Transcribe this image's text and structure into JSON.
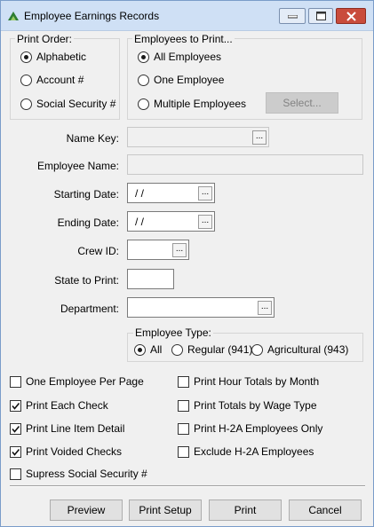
{
  "window": {
    "title": "Employee Earnings Records"
  },
  "print_order": {
    "legend": "Print Order:",
    "options": [
      "Alphabetic",
      "Account #",
      "Social Security #"
    ],
    "selected": "Alphabetic"
  },
  "employees_to_print": {
    "legend": "Employees to Print...",
    "options": [
      "All Employees",
      "One Employee",
      "Multiple Employees"
    ],
    "selected": "All Employees",
    "select_button": "Select..."
  },
  "fields": {
    "name_key": {
      "label": "Name Key:",
      "value": ""
    },
    "employee_name": {
      "label": "Employee Name:",
      "value": ""
    },
    "starting_date": {
      "label": "Starting Date:",
      "value": "/ /"
    },
    "ending_date": {
      "label": "Ending Date:",
      "value": "/ /"
    },
    "crew_id": {
      "label": "Crew ID:",
      "value": ""
    },
    "state_to_print": {
      "label": "State to Print:",
      "value": ""
    },
    "department": {
      "label": "Department:",
      "value": ""
    }
  },
  "ellipsis": "...",
  "employee_type": {
    "legend": "Employee Type:",
    "options": [
      "All",
      "Regular (941)",
      "Agricultural (943)"
    ],
    "selected": "All"
  },
  "checkboxes": {
    "left": [
      {
        "label": "One Employee Per Page",
        "checked": false
      },
      {
        "label": "Print Each Check",
        "checked": true
      },
      {
        "label": "Print Line Item Detail",
        "checked": true
      },
      {
        "label": "Print Voided Checks",
        "checked": true
      },
      {
        "label": "Supress Social Security #",
        "checked": false
      }
    ],
    "right": [
      {
        "label": "Print Hour Totals by Month",
        "checked": false
      },
      {
        "label": "Print Totals by Wage Type",
        "checked": false
      },
      {
        "label": "Print H-2A Employees Only",
        "checked": false
      },
      {
        "label": "Exclude H-2A Employees",
        "checked": false
      }
    ]
  },
  "buttons": {
    "preview": "Preview",
    "print_setup": "Print Setup",
    "print": "Print",
    "cancel": "Cancel"
  }
}
